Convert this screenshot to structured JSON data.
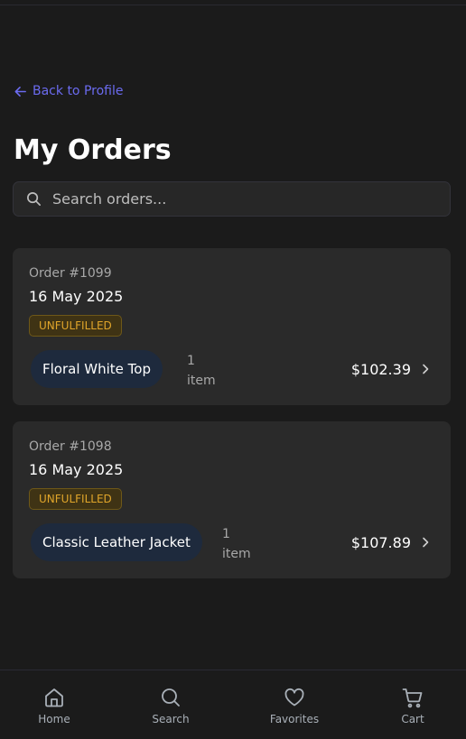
{
  "nav": {
    "back_label": "Back to Profile"
  },
  "page": {
    "title": "My Orders"
  },
  "search": {
    "placeholder": "Search orders..."
  },
  "orders": [
    {
      "number": "Order #1099",
      "date": "16 May 2025",
      "status": "UNFULFILLED",
      "product": "Floral White Top",
      "count": "1",
      "count_unit": "item",
      "total": "$102.39"
    },
    {
      "number": "Order #1098",
      "date": "16 May 2025",
      "status": "UNFULFILLED",
      "product": "Classic Leather Jacket",
      "count": "1",
      "count_unit": "item",
      "total": "$107.89"
    }
  ],
  "bottom_nav": {
    "items": [
      {
        "label": "Home",
        "icon": "home-icon"
      },
      {
        "label": "Search",
        "icon": "search-icon"
      },
      {
        "label": "Favorites",
        "icon": "heart-icon"
      },
      {
        "label": "Cart",
        "icon": "cart-icon"
      }
    ]
  },
  "colors": {
    "background": "#1b1b1b",
    "card": "#2a2a2a",
    "accent_link": "#6b6bf0",
    "badge_text": "#e0a52a",
    "badge_bg": "#3f3314",
    "pill_bg": "#1e2a3d"
  }
}
